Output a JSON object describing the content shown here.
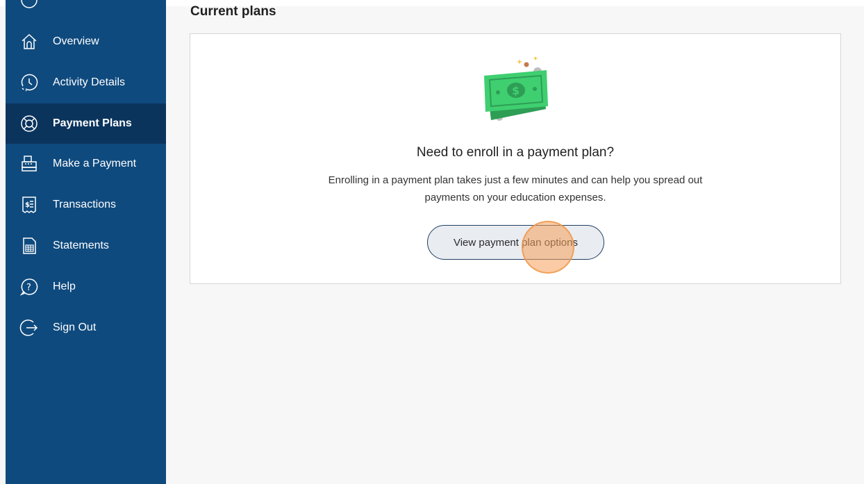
{
  "sidebar": {
    "items": [
      {
        "label": "Overview",
        "icon": "home-icon"
      },
      {
        "label": "Activity Details",
        "icon": "clock-icon"
      },
      {
        "label": "Payment Plans",
        "icon": "lifebuoy-icon",
        "active": true
      },
      {
        "label": "Make a Payment",
        "icon": "register-icon"
      },
      {
        "label": "Transactions",
        "icon": "receipt-icon"
      },
      {
        "label": "Statements",
        "icon": "document-icon"
      },
      {
        "label": "Help",
        "icon": "help-icon"
      },
      {
        "label": "Sign Out",
        "icon": "sign-out-icon"
      }
    ]
  },
  "main": {
    "title": "Current plans",
    "card": {
      "illustration": "money-icon",
      "heading": "Need to enroll in a payment plan?",
      "body": "Enrolling in a payment plan takes just a few minutes and can help you spread out payments on your education expenses.",
      "button_label": "View payment plan options"
    }
  },
  "colors": {
    "sidebar_bg": "#0f4a7e",
    "sidebar_active_bg": "#0b345d",
    "button_border": "#1f3f63",
    "click_indicator": "#f5a05a"
  }
}
